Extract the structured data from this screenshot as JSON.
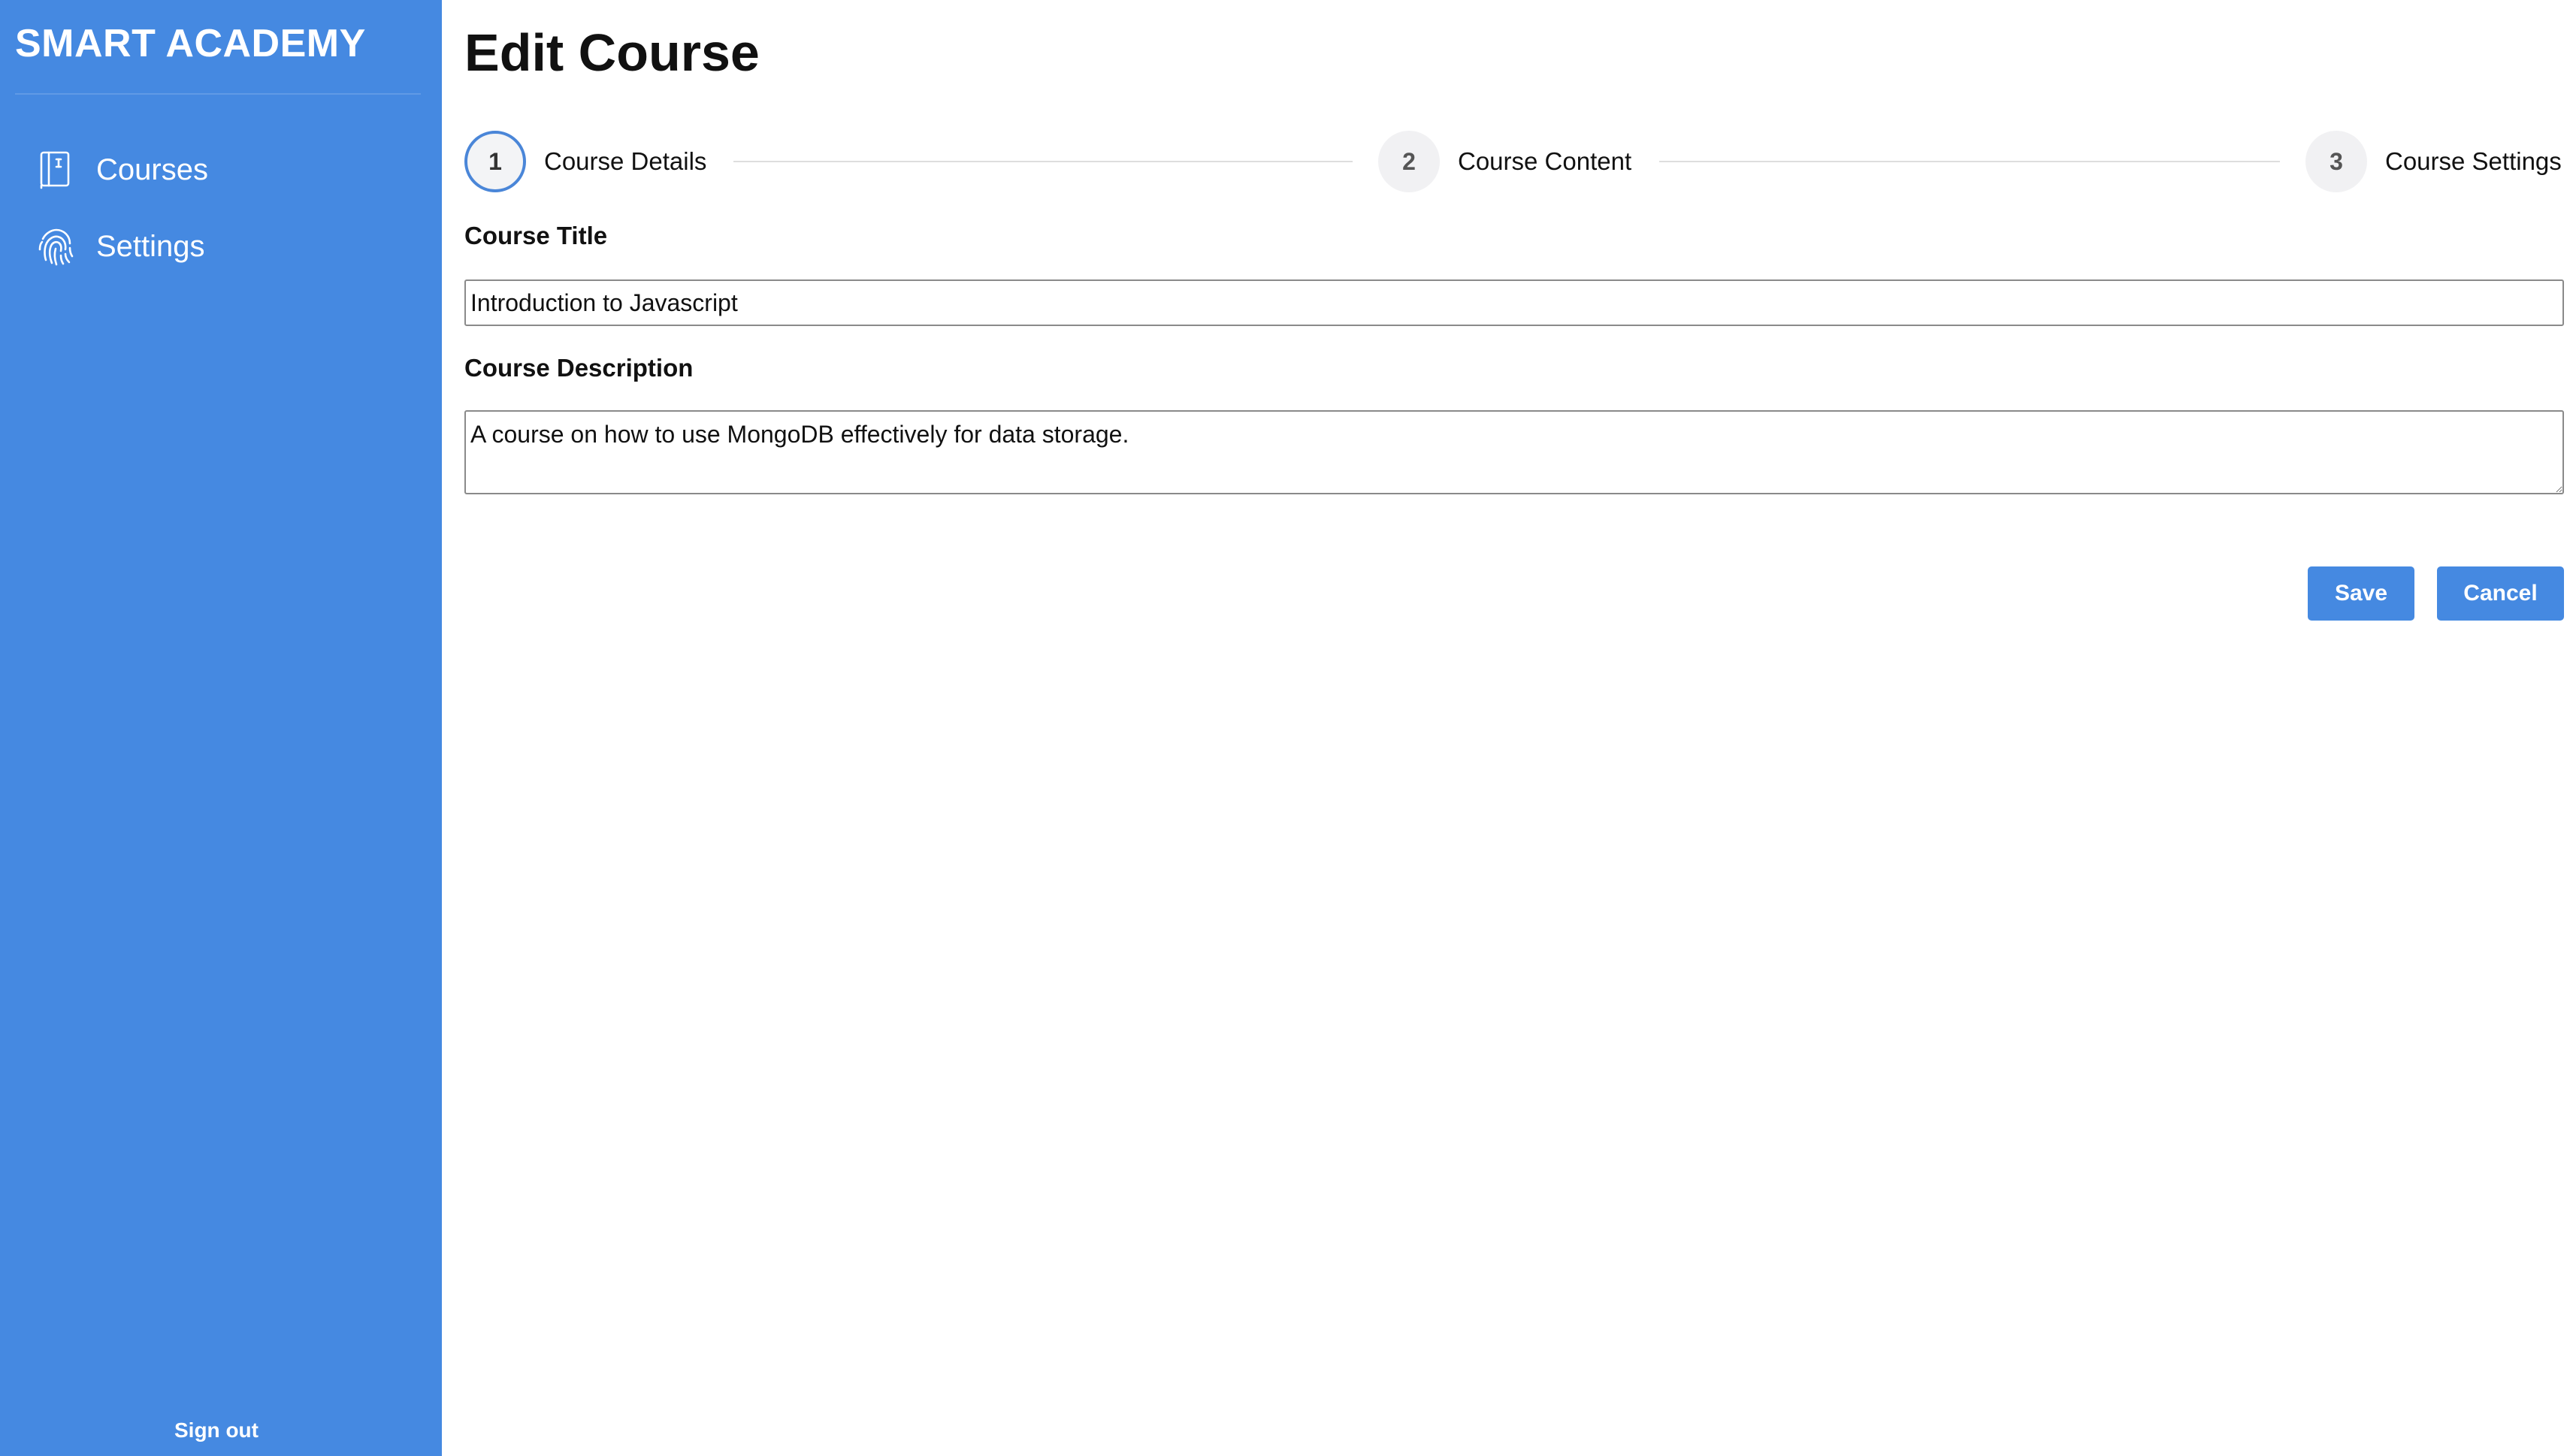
{
  "sidebar": {
    "brand": "SMART ACADEMY",
    "items": [
      {
        "label": "Courses",
        "icon": "book-icon"
      },
      {
        "label": "Settings",
        "icon": "fingerprint-icon"
      }
    ],
    "signout_label": "Sign out",
    "background_color": "#4589e1"
  },
  "main": {
    "title": "Edit Course",
    "stepper": {
      "active_step": 1,
      "steps": [
        {
          "number": "1",
          "label": "Course Details"
        },
        {
          "number": "2",
          "label": "Course Content"
        },
        {
          "number": "3",
          "label": "Course Settings"
        }
      ]
    },
    "form": {
      "title_label": "Course Title",
      "title_value": "Introduction to Javascript",
      "description_label": "Course Description",
      "description_value": "A course on how to use MongoDB effectively for data storage."
    },
    "actions": {
      "save_label": "Save",
      "cancel_label": "Cancel"
    }
  },
  "colors": {
    "accent": "#4589e1",
    "step_active_border": "#4a86d8"
  }
}
